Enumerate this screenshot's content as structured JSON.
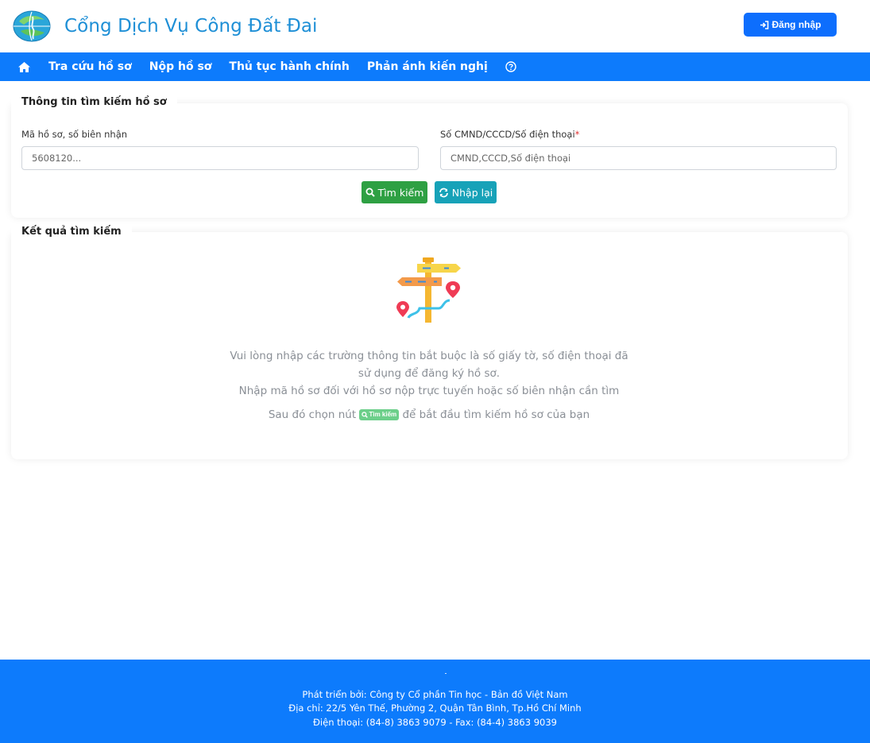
{
  "header": {
    "title": "Cổng Dịch Vụ Công Đất Đai",
    "login_label": "Đăng nhập"
  },
  "nav": {
    "items": [
      {
        "label": "Tra cứu hồ sơ"
      },
      {
        "label": "Nộp hồ sơ"
      },
      {
        "label": "Thủ tục hành chính"
      },
      {
        "label": "Phản ánh kiến nghị"
      }
    ]
  },
  "search_panel": {
    "title": "Thông tin tìm kiếm hồ sơ",
    "record_label": "Mã hồ sơ, số biên nhận",
    "record_placeholder": "5608120...",
    "id_label": "Số CMND/CCCD/Số điện thoại",
    "id_required_mark": "*",
    "id_placeholder": "CMND,CCCD,Số điện thoại",
    "search_button": "Tìm kiếm",
    "reset_button": "Nhập lại"
  },
  "result_panel": {
    "title": "Kết quả tìm kiếm",
    "line1": "Vui lòng nhập các trường thông tin bắt buộc là số giấy tờ, số điện thoại đã sử dụng để đăng ký hồ sơ.",
    "line2": "Nhập mã hồ sơ đối với hồ sơ nộp trực tuyến hoặc số biên nhận cần tìm",
    "line3_before": "Sau đó chọn nút",
    "line3_badge": "Tìm kiếm",
    "line3_after": "để bắt đầu tìm kiếm hồ sơ của bạn"
  },
  "footer": {
    "developer": "Phát triển bởi: Công ty Cổ phần Tin học - Bản đồ Việt Nam",
    "address": "Địa chỉ: 22/5 Yên Thế, Phường 2, Quận Tân Bình, Tp.Hồ Chí Minh",
    "phone": "Điện thoại: (84-8) 3863 9079 - Fax: (84-4) 3863 9039"
  },
  "colors": {
    "primary": "#0d7bfc",
    "title": "#1e8fd6",
    "success": "#2ea043",
    "info": "#17a2b8"
  }
}
